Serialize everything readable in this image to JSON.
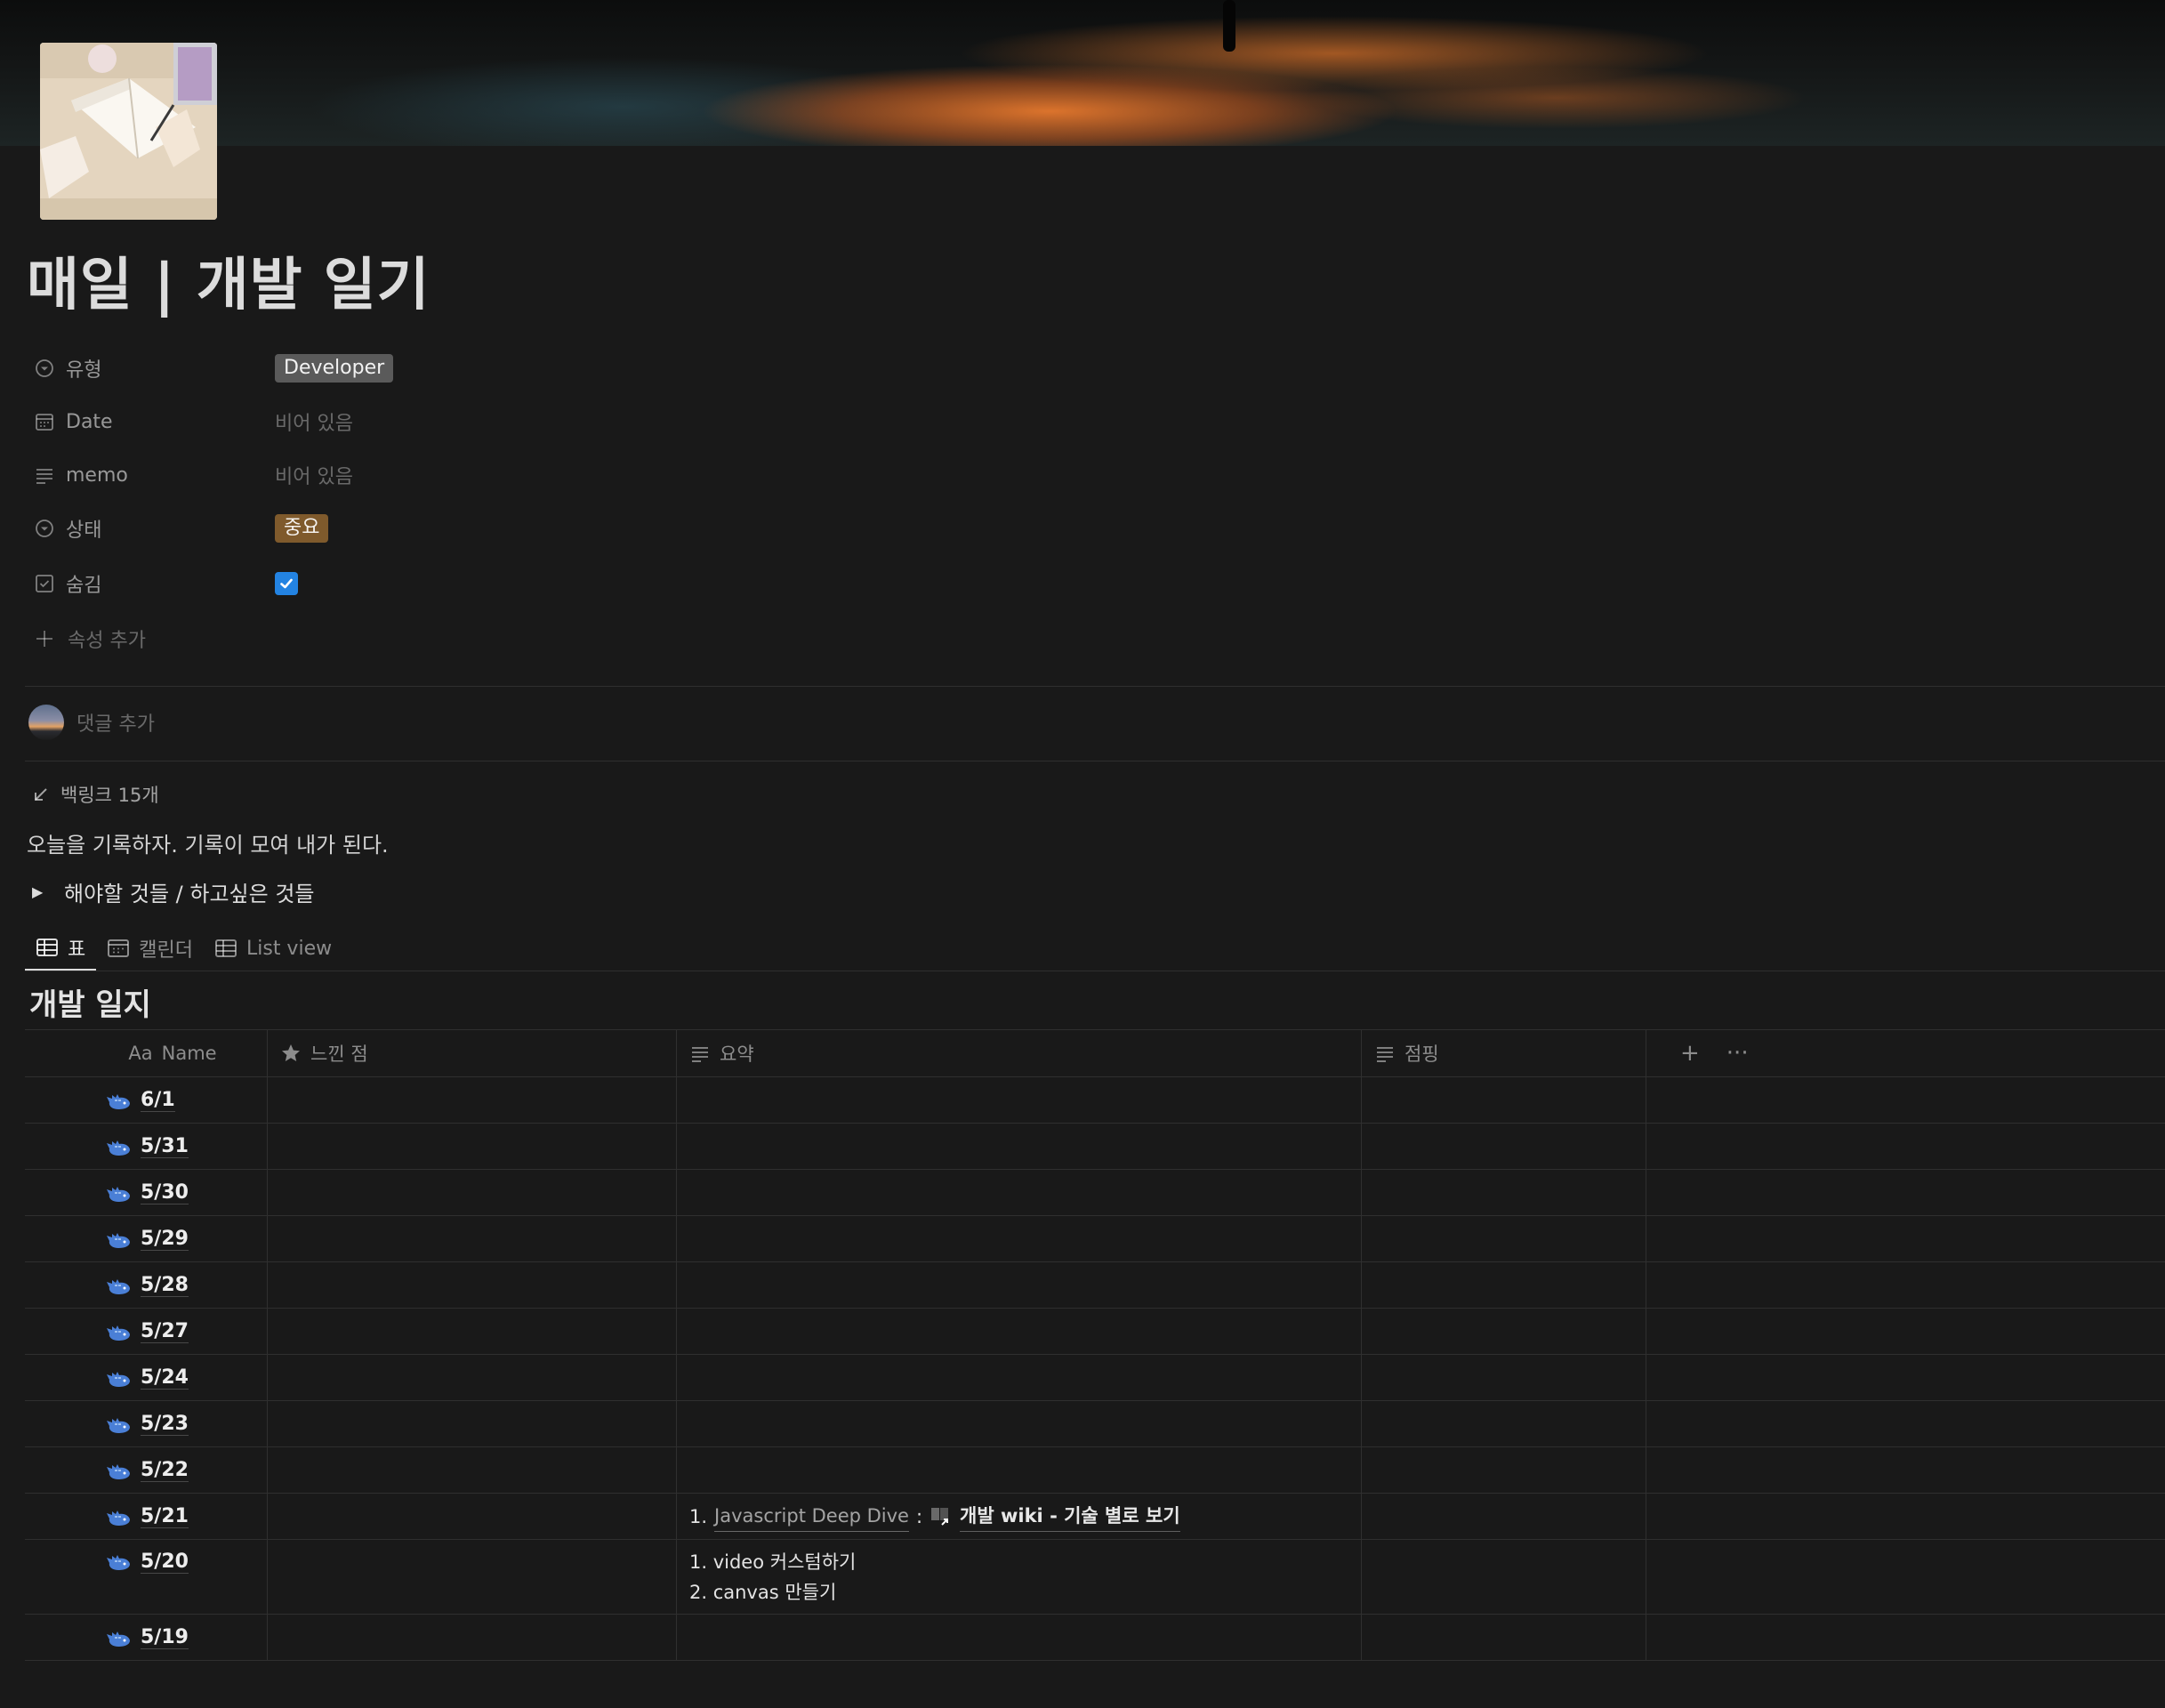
{
  "page": {
    "title": "매일 | 개발 일기",
    "properties": [
      {
        "icon": "select-icon",
        "name": "유형",
        "value": "Developer",
        "kind": "tag",
        "tag_color": "#5a5a5a"
      },
      {
        "icon": "calendar-icon",
        "name": "Date",
        "value": "비어 있음",
        "kind": "empty"
      },
      {
        "icon": "text-lines-icon",
        "name": "memo",
        "value": "비어 있음",
        "kind": "empty"
      },
      {
        "icon": "select-icon",
        "name": "상태",
        "value": "중요",
        "kind": "tag",
        "tag_color": "#7f5a2c"
      },
      {
        "icon": "checkbox-icon",
        "name": "숨김",
        "value": true,
        "kind": "checkbox"
      }
    ],
    "add_property": "속성 추가",
    "add_comment": "댓글 추가",
    "backlinks": "백링크 15개",
    "paragraph": "오늘을 기록하자. 기록이 모여 내가 된다.",
    "toggle": "해야할 것들 / 하고싶은 것들"
  },
  "views": {
    "tabs": [
      "표",
      "캘린더",
      "List view"
    ],
    "active": "표"
  },
  "database": {
    "title": "개발 일지",
    "columns": {
      "name": "Name",
      "name_prefix": "Aa",
      "feel": "느낀 점",
      "summary": "요약",
      "jumping": "점핑"
    },
    "rows": [
      {
        "name": "6/1"
      },
      {
        "name": "5/31"
      },
      {
        "name": "5/30"
      },
      {
        "name": "5/29"
      },
      {
        "name": "5/28"
      },
      {
        "name": "5/27"
      },
      {
        "name": "5/24"
      },
      {
        "name": "5/23"
      },
      {
        "name": "5/22"
      },
      {
        "name": "5/21",
        "summary_num": "1.",
        "summary_link": "Javascript Deep Dive",
        "summary_sep": ":",
        "summary_mention": "개발 wiki - 기술 별로 보기"
      },
      {
        "name": "5/20",
        "summary_line1": "1. video 커스텀하기",
        "summary_line2": "2. canvas 만들기"
      },
      {
        "name": "5/19"
      }
    ]
  },
  "colors": {
    "background": "#191919",
    "accent_blue": "#2383e2",
    "whale_icon": "#4a7fd6"
  }
}
